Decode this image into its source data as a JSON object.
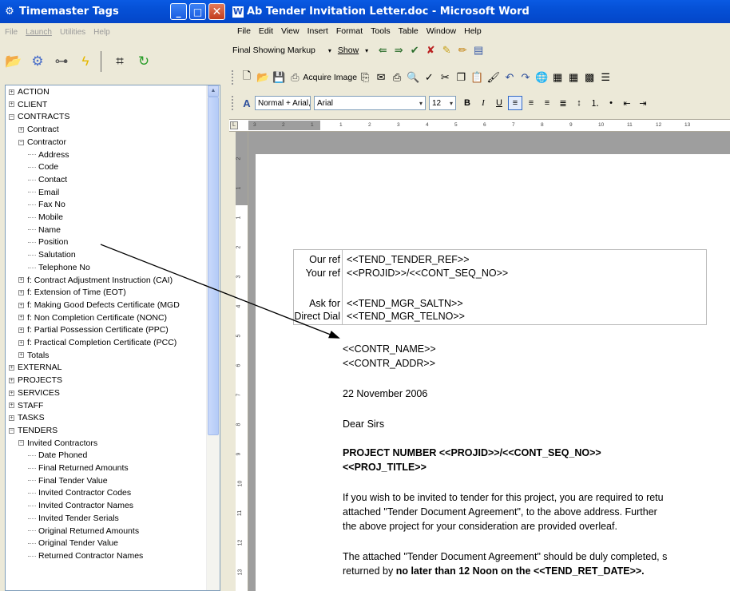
{
  "left_window": {
    "title": "Timemaster Tags",
    "menu": [
      "File",
      "Launch",
      "Utilities",
      "Help"
    ],
    "tree": [
      {
        "label": "ACTION",
        "depth": 0,
        "state": "collapsed"
      },
      {
        "label": "CLIENT",
        "depth": 0,
        "state": "collapsed"
      },
      {
        "label": "CONTRACTS",
        "depth": 0,
        "state": "expanded"
      },
      {
        "label": "Contract",
        "depth": 1,
        "state": "collapsed"
      },
      {
        "label": "Contractor",
        "depth": 1,
        "state": "expanded"
      },
      {
        "label": "Address",
        "depth": 2,
        "state": "leaf"
      },
      {
        "label": "Code",
        "depth": 2,
        "state": "leaf"
      },
      {
        "label": "Contact",
        "depth": 2,
        "state": "leaf"
      },
      {
        "label": "Email",
        "depth": 2,
        "state": "leaf"
      },
      {
        "label": "Fax No",
        "depth": 2,
        "state": "leaf"
      },
      {
        "label": "Mobile",
        "depth": 2,
        "state": "leaf"
      },
      {
        "label": "Name",
        "depth": 2,
        "state": "leaf"
      },
      {
        "label": "Position",
        "depth": 2,
        "state": "leaf"
      },
      {
        "label": "Salutation",
        "depth": 2,
        "state": "leaf"
      },
      {
        "label": "Telephone No",
        "depth": 2,
        "state": "leaf"
      },
      {
        "label": "f: Contract Adjustment Instruction (CAI)",
        "depth": 1,
        "state": "collapsed"
      },
      {
        "label": "f: Extension of Time (EOT)",
        "depth": 1,
        "state": "collapsed"
      },
      {
        "label": "f: Making Good Defects Certificate (MGD",
        "depth": 1,
        "state": "collapsed"
      },
      {
        "label": "f: Non Completion Certificate (NONC)",
        "depth": 1,
        "state": "collapsed"
      },
      {
        "label": "f: Partial Possession Certificate (PPC)",
        "depth": 1,
        "state": "collapsed"
      },
      {
        "label": "f: Practical Completion Certificate (PCC)",
        "depth": 1,
        "state": "collapsed"
      },
      {
        "label": "Totals",
        "depth": 1,
        "state": "collapsed"
      },
      {
        "label": "EXTERNAL",
        "depth": 0,
        "state": "collapsed"
      },
      {
        "label": "PROJECTS",
        "depth": 0,
        "state": "collapsed"
      },
      {
        "label": "SERVICES",
        "depth": 0,
        "state": "collapsed"
      },
      {
        "label": "STAFF",
        "depth": 0,
        "state": "collapsed"
      },
      {
        "label": "TASKS",
        "depth": 0,
        "state": "collapsed"
      },
      {
        "label": "TENDERS",
        "depth": 0,
        "state": "expanded"
      },
      {
        "label": "Invited Contractors",
        "depth": 1,
        "state": "expanded"
      },
      {
        "label": "Date Phoned",
        "depth": 2,
        "state": "leaf"
      },
      {
        "label": "Final Returned Amounts",
        "depth": 2,
        "state": "leaf"
      },
      {
        "label": "Final Tender Value",
        "depth": 2,
        "state": "leaf"
      },
      {
        "label": "Invited Contractor Codes",
        "depth": 2,
        "state": "leaf"
      },
      {
        "label": "Invited Contractor Names",
        "depth": 2,
        "state": "leaf"
      },
      {
        "label": "Invited Tender Serials",
        "depth": 2,
        "state": "leaf"
      },
      {
        "label": "Original Returned Amounts",
        "depth": 2,
        "state": "leaf"
      },
      {
        "label": "Original Tender Value",
        "depth": 2,
        "state": "leaf"
      },
      {
        "label": "Returned Contractor Names",
        "depth": 2,
        "state": "leaf"
      }
    ]
  },
  "word": {
    "title": "Ab Tender Invitation Letter.doc - Microsoft Word",
    "menu": [
      "File",
      "Edit",
      "View",
      "Insert",
      "Format",
      "Tools",
      "Table",
      "Window",
      "Help"
    ],
    "reviewing": {
      "markup_combo": "Final Showing Markup",
      "show_label": "Show"
    },
    "standard": {
      "acquire_image": "Acquire Image"
    },
    "formatting": {
      "style": "Normal + Arial,",
      "font": "Arial",
      "size": "12",
      "bold": "B",
      "italic": "I",
      "underline": "U"
    },
    "ruler_numbers": [
      "3",
      "2",
      "1",
      "1",
      "2",
      "3",
      "4",
      "5",
      "6",
      "7",
      "8",
      "9",
      "10",
      "11",
      "12",
      "13"
    ],
    "vruler_numbers": [
      "2",
      "1",
      "1",
      "2",
      "3",
      "4",
      "5",
      "6",
      "7",
      "8",
      "9",
      "10",
      "11",
      "12",
      "13"
    ],
    "document": {
      "refs": [
        {
          "label": "Our ref",
          "value": "<<TEND_TENDER_REF>>"
        },
        {
          "label": "Your ref",
          "value": "<<PROJID>>/<<CONT_SEQ_NO>>"
        },
        {
          "label": "Ask for",
          "value": "<<TEND_MGR_SALTN>>"
        },
        {
          "label": "Direct Dial",
          "value": "<<TEND_MGR_TELNO>>"
        }
      ],
      "contr_name": "<<CONTR_NAME>>",
      "contr_addr": "<<CONTR_ADDR>>",
      "date": "22 November 2006",
      "salutation": "Dear Sirs",
      "heading1": "PROJECT NUMBER <<PROJID>>/<<CONT_SEQ_NO>>",
      "heading2": "<<PROJ_TITLE>>",
      "para1": [
        "If you wish to be invited to tender for this project, you are required to retu",
        "attached \"Tender Document Agreement\", to the above address.  Further",
        "the above project for your consideration are provided overleaf."
      ],
      "para2_line1": "The attached \"Tender Document Agreement\" should be duly completed, s",
      "para2_line2_prefix": "returned by ",
      "para2_line2_bold": "no later than 12 Noon on the <<TEND_RET_DATE>>."
    }
  }
}
